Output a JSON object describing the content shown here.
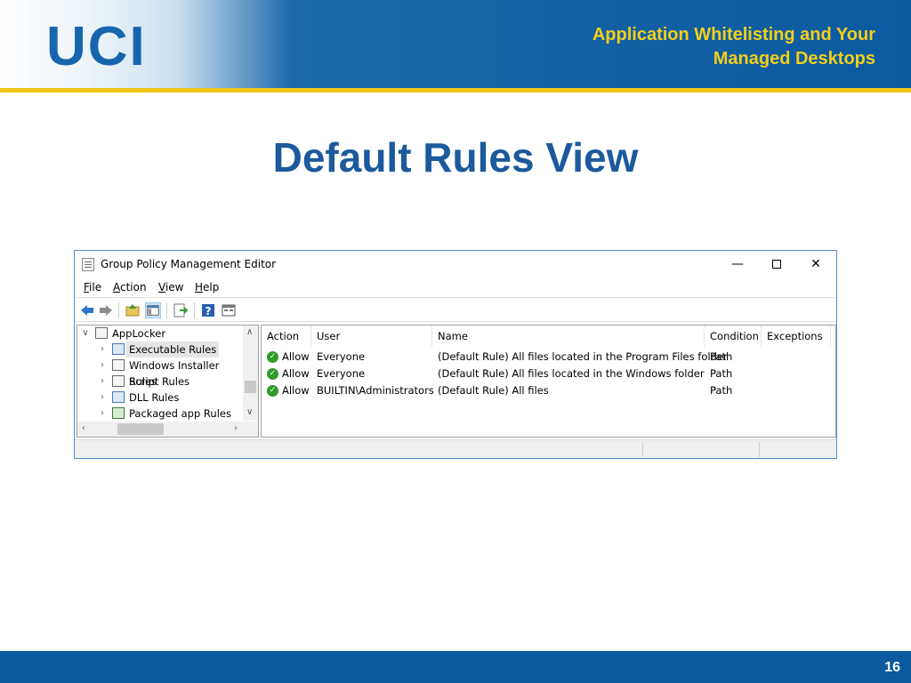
{
  "slide": {
    "logo": "UCI",
    "header_title_line1": "Application Whitelisting and Your",
    "header_title_line2": "Managed Desktops",
    "title": "Default Rules View",
    "page_number": "16",
    "colors": {
      "header_blue": "#0b5aa0",
      "accent_yellow": "#f2c516",
      "title_blue": "#1b5a9c"
    }
  },
  "window": {
    "title": "Group Policy Management Editor",
    "controls": {
      "minimize": "—",
      "close": "✕"
    },
    "menu": [
      {
        "label": "File",
        "accel": "F",
        "rest": "ile"
      },
      {
        "label": "Action",
        "accel": "A",
        "rest": "ction"
      },
      {
        "label": "View",
        "accel": "V",
        "rest": "iew"
      },
      {
        "label": "Help",
        "accel": "H",
        "rest": "elp"
      }
    ],
    "toolbar_icons": [
      "back-arrow-icon",
      "forward-arrow-icon",
      "up-folder-icon",
      "show-hide-tree-icon",
      "export-list-icon",
      "help-icon",
      "properties-icon"
    ],
    "tree": {
      "root": "AppLocker",
      "items": [
        "Executable Rules",
        "Windows Installer Rules",
        "Script Rules",
        "DLL Rules",
        "Packaged app Rules"
      ],
      "selected": "Executable Rules"
    },
    "list": {
      "columns": [
        "Action",
        "User",
        "Name",
        "Condition",
        "Exceptions"
      ],
      "rows": [
        {
          "action": "Allow",
          "user": "Everyone",
          "name": "(Default Rule) All files located in the Program Files folder",
          "condition": "Path",
          "exceptions": ""
        },
        {
          "action": "Allow",
          "user": "Everyone",
          "name": "(Default Rule) All files located in the Windows folder",
          "condition": "Path",
          "exceptions": ""
        },
        {
          "action": "Allow",
          "user": "BUILTIN\\Administrators",
          "name": "(Default Rule) All files",
          "condition": "Path",
          "exceptions": ""
        }
      ]
    }
  }
}
